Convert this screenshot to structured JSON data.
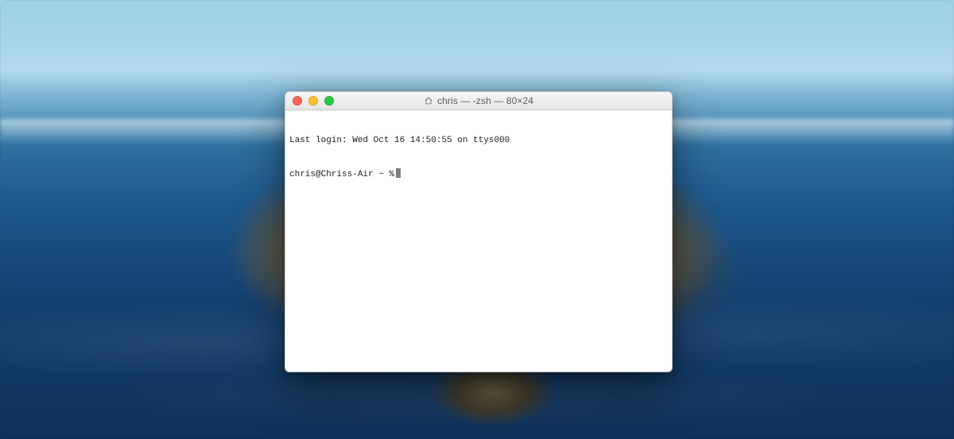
{
  "window": {
    "title": "chris — -zsh — 80×24"
  },
  "terminal": {
    "last_login": "Last login: Wed Oct 16 14:50:55 on ttys000",
    "prompt": "chris@Chriss-Air ~ %"
  }
}
